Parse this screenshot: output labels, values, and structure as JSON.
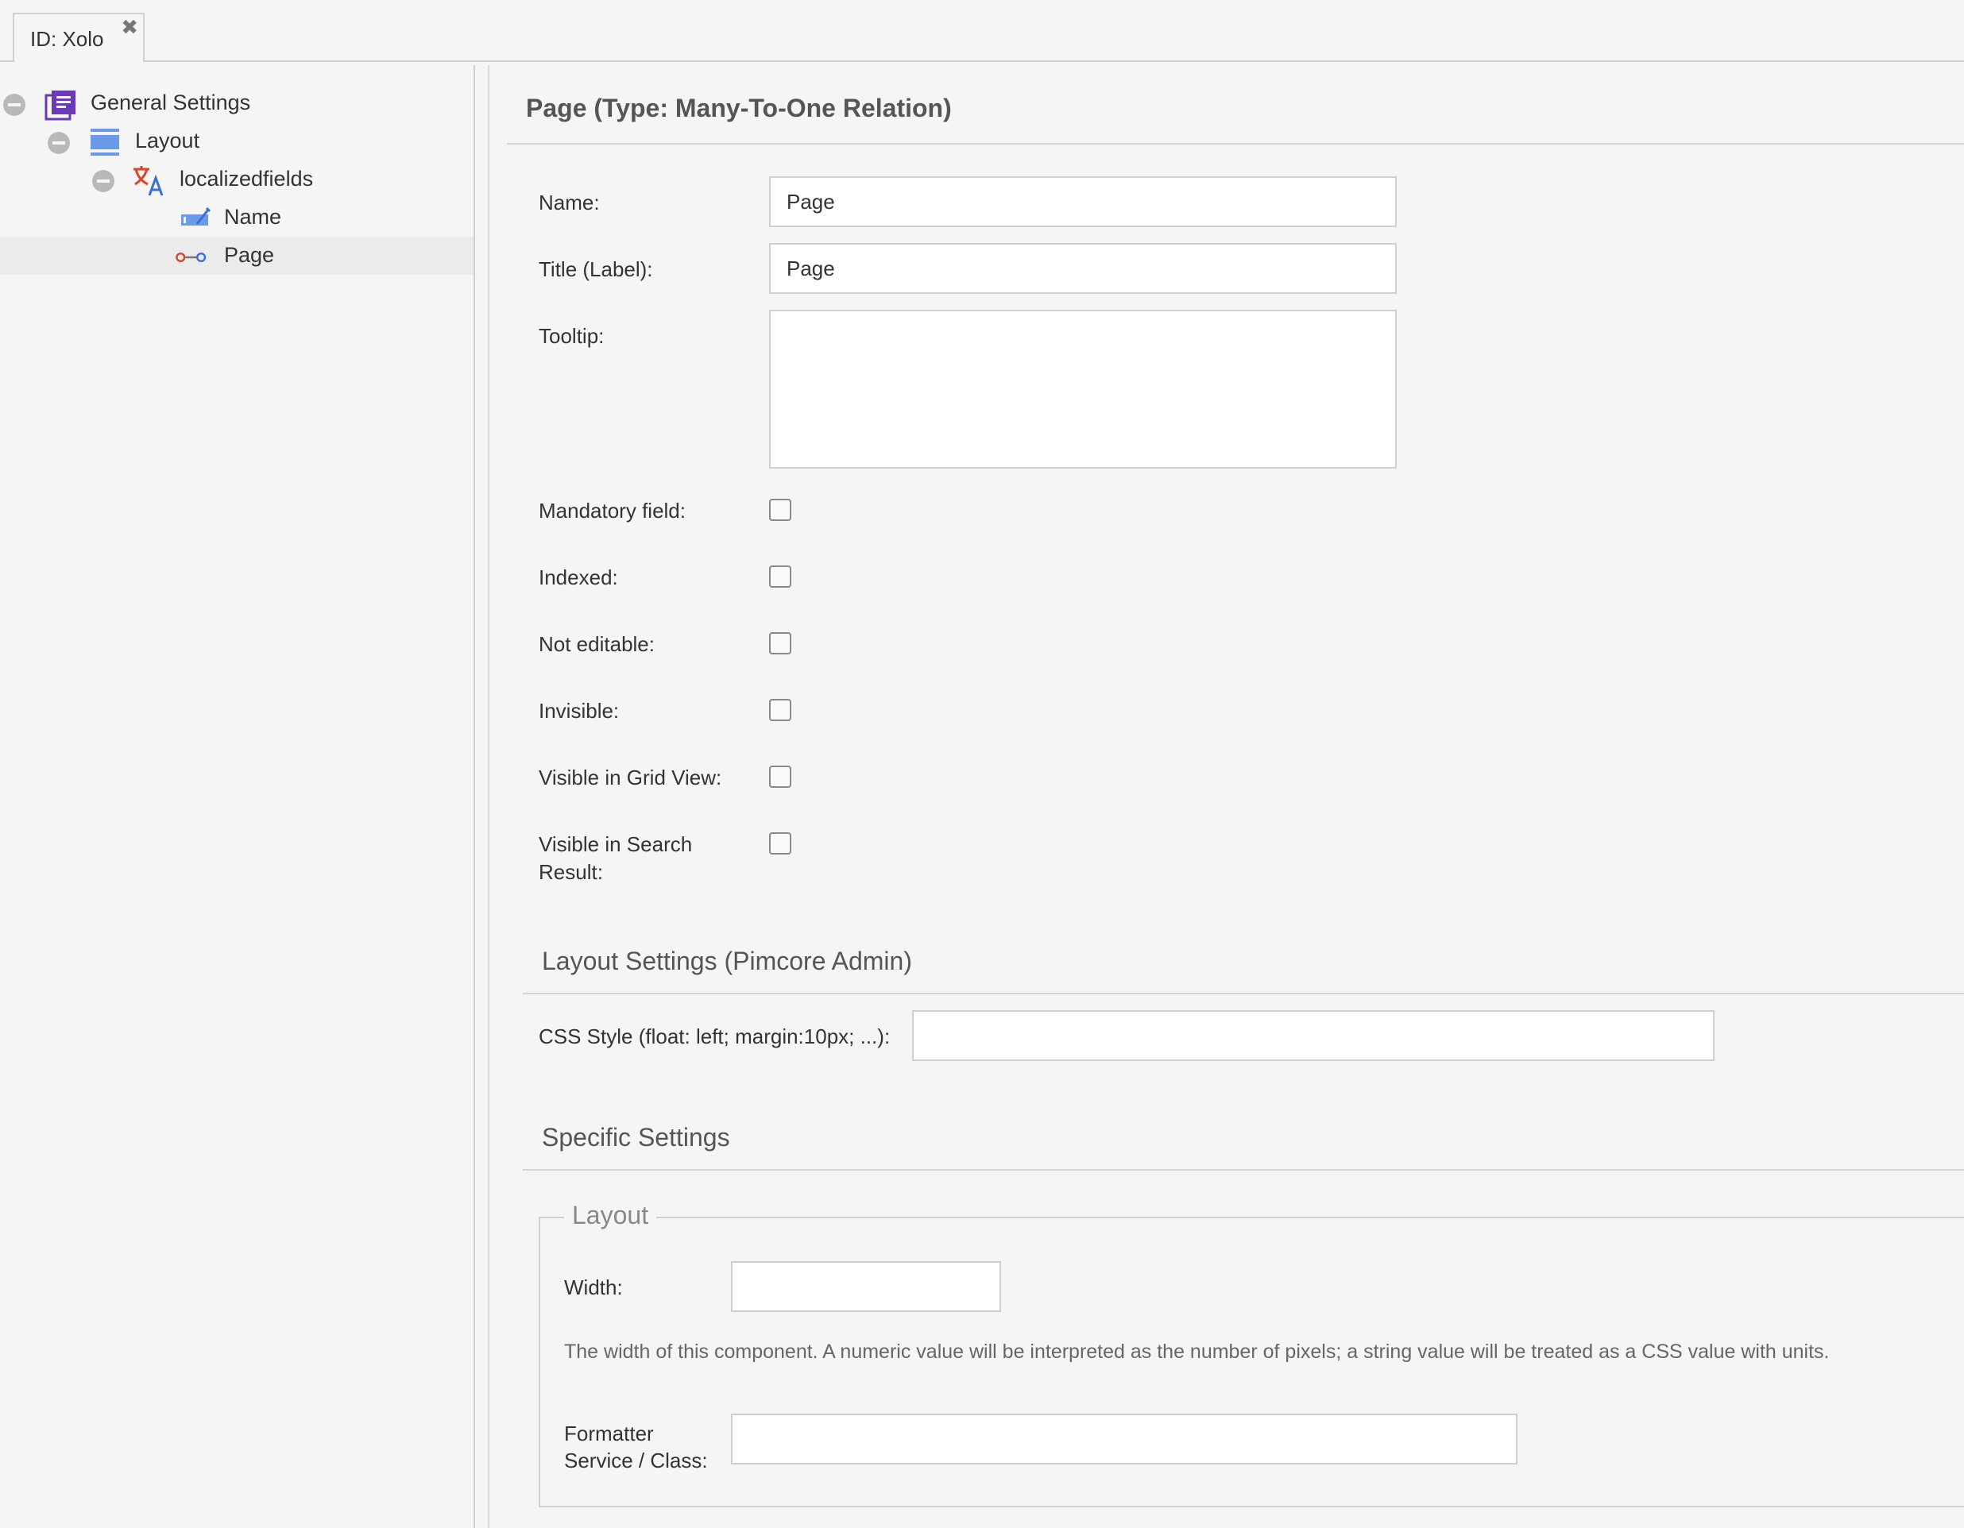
{
  "tab": {
    "title": "ID: Xolo",
    "close_glyph": "✖"
  },
  "tree": {
    "items": [
      {
        "label": "General Settings",
        "icon": "class-definition-icon",
        "collapsible": true
      },
      {
        "label": "Layout",
        "icon": "layout-panel-icon",
        "collapsible": true
      },
      {
        "label": "localizedfields",
        "icon": "translate-icon",
        "collapsible": true
      },
      {
        "label": "Name",
        "icon": "input-field-icon",
        "collapsible": false
      },
      {
        "label": "Page",
        "icon": "relation-icon",
        "collapsible": false,
        "selected": true
      }
    ]
  },
  "panel": {
    "title": "Page (Type: Many-To-One Relation)",
    "fields": {
      "name_label": "Name:",
      "name_value": "Page",
      "title_label": "Title (Label):",
      "title_value": "Page",
      "tooltip_label": "Tooltip:",
      "tooltip_value": ""
    },
    "checkboxes": [
      {
        "label": "Mandatory field:",
        "checked": false
      },
      {
        "label": "Indexed:",
        "checked": false
      },
      {
        "label": "Not editable:",
        "checked": false
      },
      {
        "label": "Invisible:",
        "checked": false
      },
      {
        "label": "Visible in Grid View:",
        "checked": false
      },
      {
        "label": "Visible in Search Result:",
        "checked": false
      }
    ],
    "layout_settings": {
      "title": "Layout Settings (Pimcore Admin)",
      "css_style_label": "CSS Style (float: left; margin:10px; ...):",
      "css_style_value": ""
    },
    "specific_settings": {
      "title": "Specific Settings",
      "layout_legend": "Layout",
      "width_label": "Width:",
      "width_value": "",
      "width_help": "The width of this component. A numeric value will be interpreted as the number of pixels; a string value will be treated as a CSS value with units.",
      "formatter_label_line1": "Formatter",
      "formatter_label_line2": "Service / Class:",
      "formatter_value": ""
    }
  },
  "colors": {
    "background": "#f5f5f5",
    "border": "#cfcfcf",
    "class_icon_purple": "#6a3ab8",
    "layout_icon_blue": "#6b9be8",
    "translate_red": "#d9452b",
    "translate_blue": "#3b6fd6",
    "relation_red": "#d9452b",
    "relation_blue": "#3b6fd6"
  }
}
